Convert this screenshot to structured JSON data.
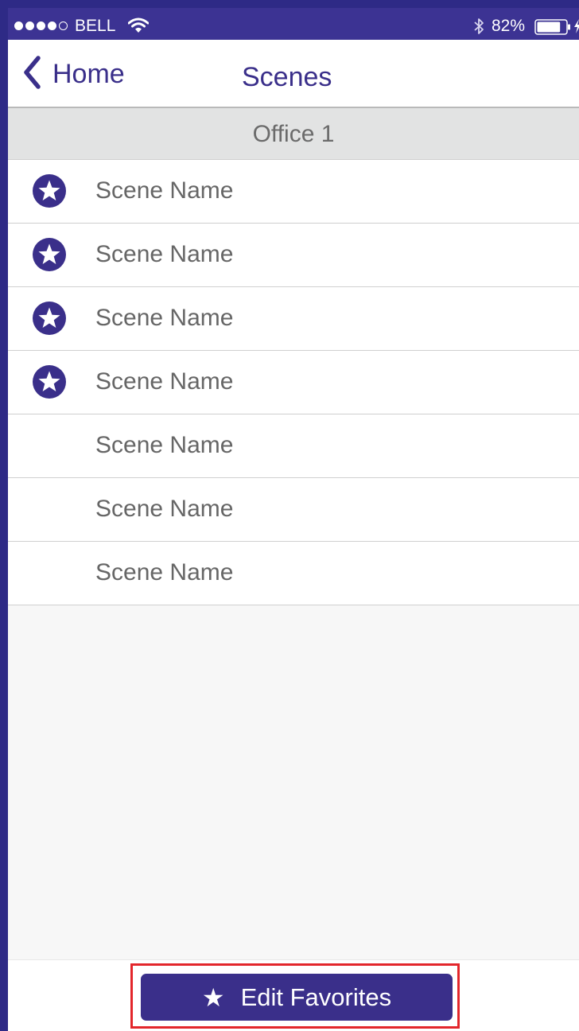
{
  "status_bar": {
    "signal": {
      "filled_dots": 4,
      "total_dots": 5,
      "icon": "signal-dots-icon"
    },
    "carrier": "BELL",
    "wifi_icon": "wifi-icon",
    "bluetooth_icon": "bluetooth-icon",
    "battery_percent": "82%",
    "battery_level": 0.82,
    "charging_icon": "charging-bolt-icon"
  },
  "nav": {
    "back_label": "Home",
    "back_icon": "chevron-left-icon",
    "title": "Scenes"
  },
  "section": {
    "title": "Office 1"
  },
  "scenes": [
    {
      "label": "Scene Name",
      "favorite": true
    },
    {
      "label": "Scene Name",
      "favorite": true
    },
    {
      "label": "Scene Name",
      "favorite": true
    },
    {
      "label": "Scene Name",
      "favorite": true
    },
    {
      "label": "Scene Name",
      "favorite": false
    },
    {
      "label": "Scene Name",
      "favorite": false
    },
    {
      "label": "Scene Name",
      "favorite": false
    }
  ],
  "footer": {
    "edit_label": "Edit Favorites",
    "edit_icon": "star-icon"
  },
  "colors": {
    "brand": "#3a2f8a",
    "status_bar": "#3c3393",
    "section_header_bg": "#e2e3e3",
    "text_gray": "#666666",
    "highlight": "#e3262b"
  }
}
